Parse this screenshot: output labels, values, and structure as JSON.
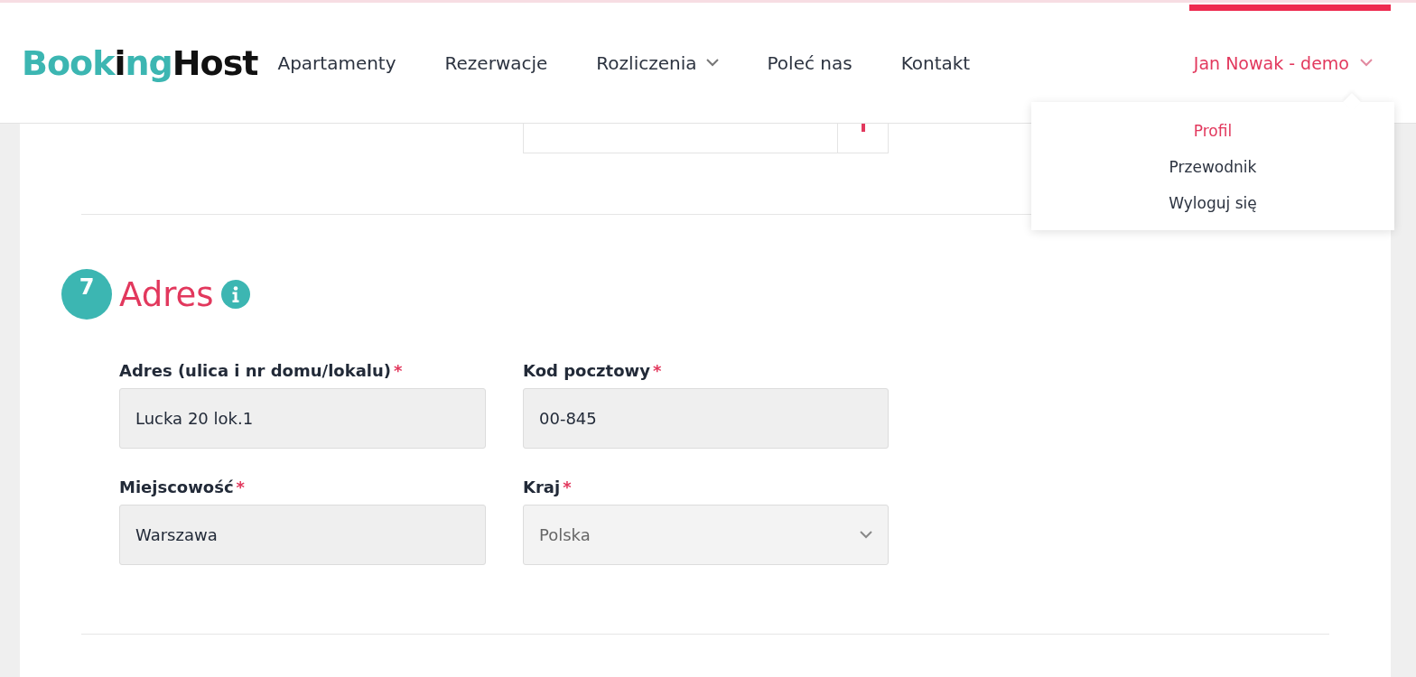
{
  "logo": [
    {
      "text": "Book",
      "kind": "teal"
    },
    {
      "text": "i",
      "kind": "dark"
    },
    {
      "text": "ng",
      "kind": "teal"
    },
    {
      "text": "Host",
      "kind": "dark"
    }
  ],
  "nav": [
    {
      "label": "Apartamenty",
      "has_menu": false
    },
    {
      "label": "Rezerwacje",
      "has_menu": false
    },
    {
      "label": "Rozliczenia",
      "has_menu": true
    },
    {
      "label": "Poleć nas",
      "has_menu": false
    },
    {
      "label": "Kontakt",
      "has_menu": false
    }
  ],
  "user_menu": {
    "label": "Jan Nowak - demo",
    "expanded": true,
    "items": [
      {
        "label": "Profil",
        "selected": true
      },
      {
        "label": "Przewodnik",
        "selected": false
      },
      {
        "label": "Wyloguj się",
        "selected": false
      }
    ]
  },
  "section": {
    "number": "7",
    "title": "Adres",
    "fields": [
      {
        "label": "Adres (ulica i nr domu/lokalu)",
        "required_mark": "*",
        "value": "Lucka 20 lok.1",
        "kind": "text"
      },
      {
        "label": "Kod pocztowy",
        "required_mark": "*",
        "value": "00-845",
        "kind": "text"
      },
      {
        "label": "Miejscowość",
        "required_mark": "*",
        "value": "Warszawa",
        "kind": "text"
      },
      {
        "label": "Kraj",
        "required_mark": "*",
        "value": "Polska",
        "kind": "select"
      }
    ]
  }
}
